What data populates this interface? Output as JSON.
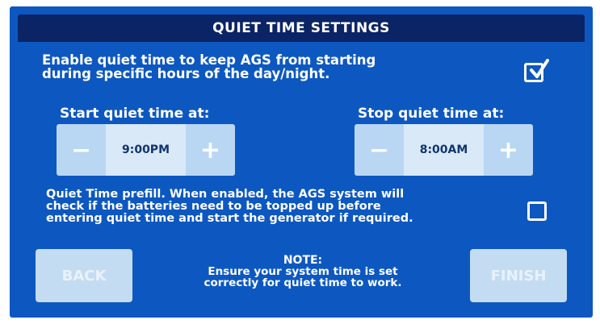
{
  "title": "QUIET TIME SETTINGS",
  "enable": {
    "line1": "Enable quiet time to keep AGS from starting",
    "line2": "during specific hours of the day/night.",
    "checked": true
  },
  "start": {
    "label": "Start quiet time at:",
    "minus": "−",
    "value": "9:00PM",
    "plus": "+"
  },
  "stop": {
    "label": "Stop quiet time at:",
    "minus": "−",
    "value": "8:00AM",
    "plus": "+"
  },
  "prefill": {
    "line1": "Quiet Time prefill. When enabled, the AGS system will",
    "line2": "check if the batteries need to be topped up before",
    "line3": "entering quiet time and start the generator if required.",
    "checked": false
  },
  "buttons": {
    "back": "BACK",
    "finish": "FINISH"
  },
  "note": {
    "title": "NOTE:",
    "line1": "Ensure your system time is set",
    "line2": "correctly for quiet time to work."
  },
  "colors": {
    "screen_bg": "#0d58c0",
    "title_bar": "#0a2466",
    "button_fill": "#c4dcf2",
    "stepper_fill": "#b9d7f3",
    "value_text": "#12356e"
  },
  "icons": {
    "checkmark": "checkmark-icon",
    "minus": "minus-icon",
    "plus": "plus-icon"
  }
}
